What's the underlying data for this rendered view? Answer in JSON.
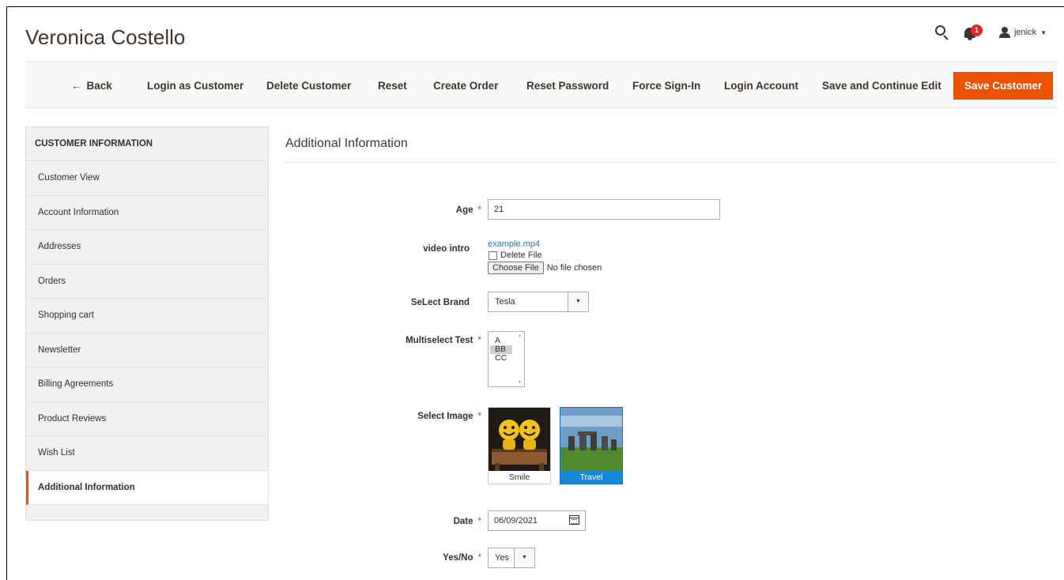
{
  "header": {
    "title": "Veronica Costello",
    "notifications_count": "1",
    "user_name": "jenick",
    "user_caret": "▼"
  },
  "toolbar": {
    "back_label": "Back",
    "login_as_customer": "Login as Customer",
    "delete_customer": "Delete Customer",
    "reset": "Reset",
    "create_order": "Create Order",
    "reset_password": "Reset Password",
    "force_sign_in": "Force Sign-In",
    "login_account": "Login Account",
    "save_continue": "Save and Continue Edit",
    "save_customer": "Save Customer"
  },
  "sidebar": {
    "title": "CUSTOMER INFORMATION",
    "items": [
      {
        "label": "Customer View"
      },
      {
        "label": "Account Information"
      },
      {
        "label": "Addresses"
      },
      {
        "label": "Orders"
      },
      {
        "label": "Shopping cart"
      },
      {
        "label": "Newsletter"
      },
      {
        "label": "Billing Agreements"
      },
      {
        "label": "Product Reviews"
      },
      {
        "label": "Wish List"
      },
      {
        "label": "Additional Information",
        "active": true
      }
    ]
  },
  "section": {
    "title": "Additional Information"
  },
  "form": {
    "required_mark": "*",
    "age": {
      "label": "Age",
      "value": "21"
    },
    "video": {
      "label": "video intro",
      "file_link": "example.mp4",
      "delete_label": "Delete File",
      "choose_button": "Choose File",
      "no_file": "No file chosen"
    },
    "brand": {
      "label": "SeLect Brand",
      "value": "Tesla"
    },
    "multiselect": {
      "label": "Multiselect Test",
      "options": [
        "A",
        "BB",
        "CC"
      ],
      "selected": "BB"
    },
    "image": {
      "label": "Select Image",
      "options": [
        {
          "caption": "Smile",
          "selected": false
        },
        {
          "caption": "Travel",
          "selected": true
        }
      ]
    },
    "date": {
      "label": "Date",
      "value": "06/09/2021"
    },
    "yesno": {
      "label": "Yes/No",
      "value": "Yes"
    }
  }
}
